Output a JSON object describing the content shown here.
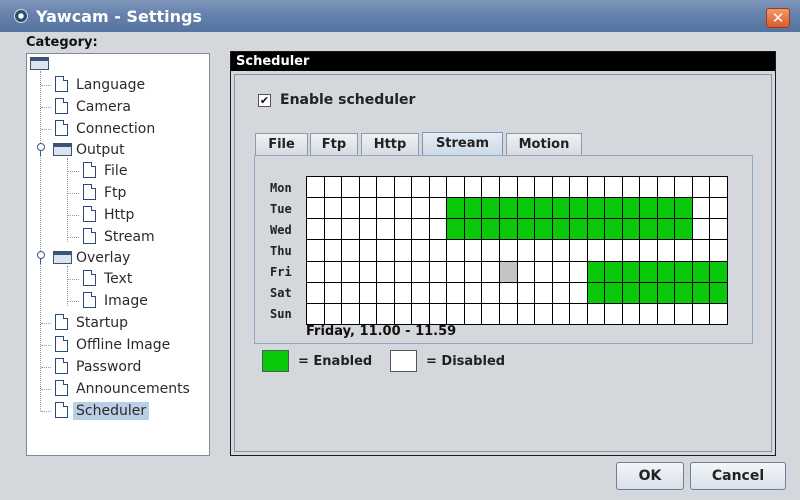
{
  "window": {
    "title": "Yawcam - Settings",
    "close_glyph": "✕"
  },
  "sidebar": {
    "heading": "Category:",
    "items": [
      {
        "label": "Language"
      },
      {
        "label": "Camera"
      },
      {
        "label": "Connection"
      },
      {
        "label": "Output"
      },
      {
        "label": "File"
      },
      {
        "label": "Ftp"
      },
      {
        "label": "Http"
      },
      {
        "label": "Stream"
      },
      {
        "label": "Overlay"
      },
      {
        "label": "Text"
      },
      {
        "label": "Image"
      },
      {
        "label": "Startup"
      },
      {
        "label": "Offline Image"
      },
      {
        "label": "Password"
      },
      {
        "label": "Announcements"
      },
      {
        "label": "Scheduler"
      }
    ],
    "selected": "Scheduler"
  },
  "panel": {
    "title": "Scheduler",
    "enable_checkbox": {
      "label": "Enable scheduler",
      "checked": true,
      "glyph": "✔"
    },
    "tabs": [
      {
        "label": "File"
      },
      {
        "label": "Ftp"
      },
      {
        "label": "Http"
      },
      {
        "label": "Stream"
      },
      {
        "label": "Motion"
      }
    ],
    "active_tab": "Stream",
    "schedule": {
      "days": [
        "Mon",
        "Tue",
        "Wed",
        "Thu",
        "Fri",
        "Sat",
        "Sun"
      ],
      "hours_per_day": 24,
      "enabled": {
        "Mon": [],
        "Tue": [
          8,
          9,
          10,
          11,
          12,
          13,
          14,
          15,
          16,
          17,
          18,
          19,
          20,
          21
        ],
        "Wed": [
          8,
          9,
          10,
          11,
          12,
          13,
          14,
          15,
          16,
          17,
          18,
          19,
          20,
          21
        ],
        "Thu": [],
        "Fri": [
          16,
          17,
          18,
          19,
          20,
          21,
          22,
          23
        ],
        "Sat": [
          16,
          17,
          18,
          19,
          20,
          21,
          22,
          23
        ],
        "Sun": []
      },
      "highlight": {
        "day": "Fri",
        "hour": 11
      },
      "hover_label": "Friday, 11.00 - 11.59"
    },
    "legend": {
      "enabled": "= Enabled",
      "disabled": "= Disabled"
    },
    "colors": {
      "enabled": "#0ac80a",
      "disabled": "#ffffff",
      "highlight": "#c4c4c4"
    }
  },
  "footer": {
    "ok": "OK",
    "cancel": "Cancel"
  }
}
